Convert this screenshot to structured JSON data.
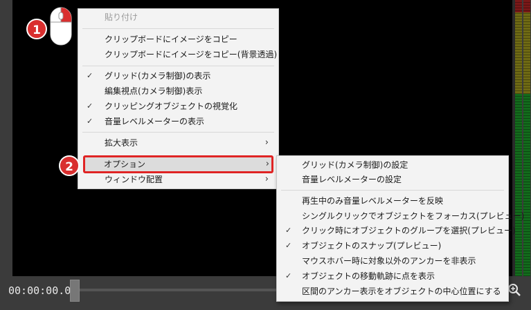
{
  "transport": {
    "timecode": "00:00:00.00"
  },
  "badges": {
    "step1": "1",
    "step2": "2"
  },
  "main_menu": {
    "paste": "貼り付け",
    "copy_image": "クリップボードにイメージをコピー",
    "copy_image_transparent": "クリップボードにイメージをコピー(背景透過)",
    "show_grid": "グリッド(カメラ制御)の表示",
    "show_edit_viewpoint": "編集視点(カメラ制御)表示",
    "visualize_clipping": "クリッピングオブジェクトの視覚化",
    "show_volume_meter": "音量レベルメーターの表示",
    "zoom_display": "拡大表示",
    "options": "オプション",
    "window_layout": "ウィンドウ配置"
  },
  "sub_menu": {
    "grid_settings": "グリッド(カメラ制御)の設定",
    "volume_meter_settings": "音量レベルメーターの設定",
    "meter_playback_only": "再生中のみ音量レベルメーターを反映",
    "single_click_focus": "シングルクリックでオブジェクトをフォーカス(プレビュー)",
    "select_group_on_click": "クリック時にオブジェクトのグループを選択(プレビュー)",
    "object_snap": "オブジェクトのスナップ(プレビュー)",
    "hide_other_anchors": "マウスホバー時に対象以外のアンカーを非表示",
    "show_motion_path_points": "オブジェクトの移動軌跡に点を表示",
    "center_section_anchor": "区間のアンカー表示をオブジェクトの中心位置にする"
  },
  "icons": {
    "check": "✓",
    "submenu_arrow": "›"
  },
  "colors": {
    "menu_bg": "#f3f3f3",
    "highlight_border": "#e02424",
    "badge": "#d92f2f",
    "meter_green": "#136b1c",
    "meter_yellow": "#6f6a14",
    "meter_red": "#7a1818"
  }
}
